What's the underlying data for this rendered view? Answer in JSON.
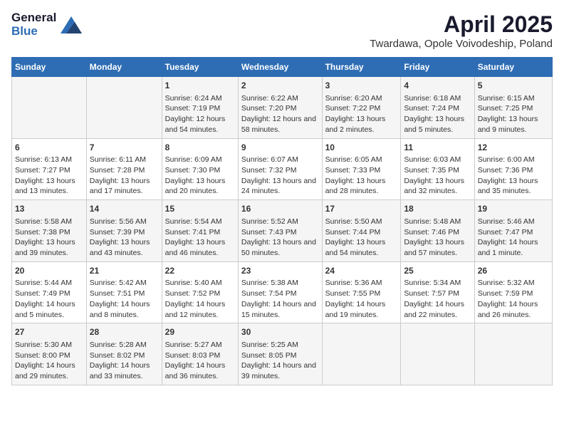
{
  "header": {
    "logo_general": "General",
    "logo_blue": "Blue",
    "title": "April 2025",
    "subtitle": "Twardawa, Opole Voivodeship, Poland"
  },
  "days_of_week": [
    "Sunday",
    "Monday",
    "Tuesday",
    "Wednesday",
    "Thursday",
    "Friday",
    "Saturday"
  ],
  "weeks": [
    [
      {
        "day": "",
        "content": ""
      },
      {
        "day": "",
        "content": ""
      },
      {
        "day": "1",
        "content": "Sunrise: 6:24 AM\nSunset: 7:19 PM\nDaylight: 12 hours and 54 minutes."
      },
      {
        "day": "2",
        "content": "Sunrise: 6:22 AM\nSunset: 7:20 PM\nDaylight: 12 hours and 58 minutes."
      },
      {
        "day": "3",
        "content": "Sunrise: 6:20 AM\nSunset: 7:22 PM\nDaylight: 13 hours and 2 minutes."
      },
      {
        "day": "4",
        "content": "Sunrise: 6:18 AM\nSunset: 7:24 PM\nDaylight: 13 hours and 5 minutes."
      },
      {
        "day": "5",
        "content": "Sunrise: 6:15 AM\nSunset: 7:25 PM\nDaylight: 13 hours and 9 minutes."
      }
    ],
    [
      {
        "day": "6",
        "content": "Sunrise: 6:13 AM\nSunset: 7:27 PM\nDaylight: 13 hours and 13 minutes."
      },
      {
        "day": "7",
        "content": "Sunrise: 6:11 AM\nSunset: 7:28 PM\nDaylight: 13 hours and 17 minutes."
      },
      {
        "day": "8",
        "content": "Sunrise: 6:09 AM\nSunset: 7:30 PM\nDaylight: 13 hours and 20 minutes."
      },
      {
        "day": "9",
        "content": "Sunrise: 6:07 AM\nSunset: 7:32 PM\nDaylight: 13 hours and 24 minutes."
      },
      {
        "day": "10",
        "content": "Sunrise: 6:05 AM\nSunset: 7:33 PM\nDaylight: 13 hours and 28 minutes."
      },
      {
        "day": "11",
        "content": "Sunrise: 6:03 AM\nSunset: 7:35 PM\nDaylight: 13 hours and 32 minutes."
      },
      {
        "day": "12",
        "content": "Sunrise: 6:00 AM\nSunset: 7:36 PM\nDaylight: 13 hours and 35 minutes."
      }
    ],
    [
      {
        "day": "13",
        "content": "Sunrise: 5:58 AM\nSunset: 7:38 PM\nDaylight: 13 hours and 39 minutes."
      },
      {
        "day": "14",
        "content": "Sunrise: 5:56 AM\nSunset: 7:39 PM\nDaylight: 13 hours and 43 minutes."
      },
      {
        "day": "15",
        "content": "Sunrise: 5:54 AM\nSunset: 7:41 PM\nDaylight: 13 hours and 46 minutes."
      },
      {
        "day": "16",
        "content": "Sunrise: 5:52 AM\nSunset: 7:43 PM\nDaylight: 13 hours and 50 minutes."
      },
      {
        "day": "17",
        "content": "Sunrise: 5:50 AM\nSunset: 7:44 PM\nDaylight: 13 hours and 54 minutes."
      },
      {
        "day": "18",
        "content": "Sunrise: 5:48 AM\nSunset: 7:46 PM\nDaylight: 13 hours and 57 minutes."
      },
      {
        "day": "19",
        "content": "Sunrise: 5:46 AM\nSunset: 7:47 PM\nDaylight: 14 hours and 1 minute."
      }
    ],
    [
      {
        "day": "20",
        "content": "Sunrise: 5:44 AM\nSunset: 7:49 PM\nDaylight: 14 hours and 5 minutes."
      },
      {
        "day": "21",
        "content": "Sunrise: 5:42 AM\nSunset: 7:51 PM\nDaylight: 14 hours and 8 minutes."
      },
      {
        "day": "22",
        "content": "Sunrise: 5:40 AM\nSunset: 7:52 PM\nDaylight: 14 hours and 12 minutes."
      },
      {
        "day": "23",
        "content": "Sunrise: 5:38 AM\nSunset: 7:54 PM\nDaylight: 14 hours and 15 minutes."
      },
      {
        "day": "24",
        "content": "Sunrise: 5:36 AM\nSunset: 7:55 PM\nDaylight: 14 hours and 19 minutes."
      },
      {
        "day": "25",
        "content": "Sunrise: 5:34 AM\nSunset: 7:57 PM\nDaylight: 14 hours and 22 minutes."
      },
      {
        "day": "26",
        "content": "Sunrise: 5:32 AM\nSunset: 7:59 PM\nDaylight: 14 hours and 26 minutes."
      }
    ],
    [
      {
        "day": "27",
        "content": "Sunrise: 5:30 AM\nSunset: 8:00 PM\nDaylight: 14 hours and 29 minutes."
      },
      {
        "day": "28",
        "content": "Sunrise: 5:28 AM\nSunset: 8:02 PM\nDaylight: 14 hours and 33 minutes."
      },
      {
        "day": "29",
        "content": "Sunrise: 5:27 AM\nSunset: 8:03 PM\nDaylight: 14 hours and 36 minutes."
      },
      {
        "day": "30",
        "content": "Sunrise: 5:25 AM\nSunset: 8:05 PM\nDaylight: 14 hours and 39 minutes."
      },
      {
        "day": "",
        "content": ""
      },
      {
        "day": "",
        "content": ""
      },
      {
        "day": "",
        "content": ""
      }
    ]
  ]
}
